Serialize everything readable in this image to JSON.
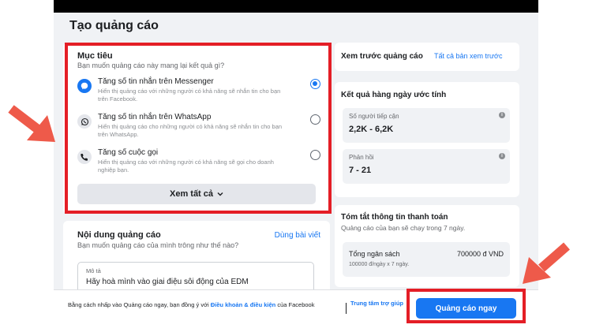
{
  "page": {
    "title": "Tạo quảng cáo"
  },
  "objective": {
    "title": "Mục tiêu",
    "subtitle": "Bạn muốn quảng cáo này mang lại kết quả gì?",
    "options": [
      {
        "label": "Tăng số tin nhắn trên Messenger",
        "description": "Hiển thị quảng cáo với những người có khả năng sẽ nhắn tin cho bạn trên Facebook.",
        "icon": "messenger-icon",
        "selected": true
      },
      {
        "label": "Tăng số tin nhắn trên WhatsApp",
        "description": "Hiển thị quảng cáo cho những người có khả năng sẽ nhắn tin cho bạn trên WhatsApp.",
        "icon": "whatsapp-icon",
        "selected": false
      },
      {
        "label": "Tăng số cuộc gọi",
        "description": "Hiển thị quảng cáo với những người có khả năng sẽ gọi cho doanh nghiệp bạn.",
        "icon": "phone-icon",
        "selected": false
      }
    ],
    "see_all_label": "Xem tất cả"
  },
  "content": {
    "title": "Nội dung quảng cáo",
    "use_post_label": "Dùng bài viết",
    "subtitle": "Bạn muốn quảng cáo của mình trông như thế nào?",
    "description_label": "Mô tả",
    "description_value": "Hãy hoà mình vào giai điệu sôi động của EDM"
  },
  "preview": {
    "title": "Xem trước quảng cáo",
    "all_previews_label": "Tất cả bản xem trước"
  },
  "daily_results": {
    "title": "Kết quả hàng ngày ước tính",
    "reach_label": "Số người tiếp cận",
    "reach_value": "2,2K - 6,2K",
    "responses_label": "Phản hồi",
    "responses_value": "7 - 21"
  },
  "payment": {
    "title": "Tóm tắt thông tin thanh toán",
    "subtitle": "Quảng cáo của bạn sẽ chạy trong 7 ngày.",
    "total_label": "Tổng ngân sách",
    "total_value": "700000 đ VND",
    "total_detail": "100000 đ/ngày x 7 ngày."
  },
  "footer": {
    "agree_prefix": "Bằng cách nhấp vào Quảng cáo ngay, bạn đồng ý với",
    "terms_link": "Điều khoản & điều kiện",
    "agree_suffix": "của Facebook",
    "help_label": "Trung tâm trợ giúp",
    "cta_label": "Quảng cáo ngay"
  },
  "colors": {
    "accent": "#1877f2",
    "highlight": "#e41e26",
    "arrow": "#ee5a4a"
  }
}
